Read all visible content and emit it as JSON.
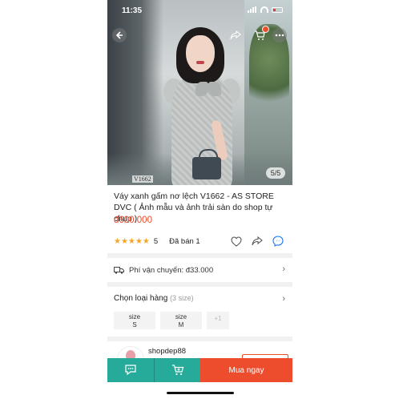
{
  "status_bar": {
    "time": "11:35"
  },
  "gallery": {
    "image_code": "V1662",
    "counter": "5/5"
  },
  "product": {
    "title": "Váy xanh gấm nơ lệch V1662 - AS STORE DVC ( Ảnh mẫu và ảnh trải sàn do shop tự chụp )",
    "price": "đ600.000",
    "stars": "★★★★★",
    "rating": "5",
    "sold": "Đã bán 1"
  },
  "shipping": {
    "label": "Phí vận chuyển: đ33.000"
  },
  "variants": {
    "label": "Chọn loại hàng",
    "count": "(3 size)",
    "options": [
      {
        "line1": "size",
        "line2": "S"
      },
      {
        "line1": "size",
        "line2": "M"
      }
    ],
    "more": "+1"
  },
  "shop": {
    "name": "shopdep88"
  },
  "bottom_bar": {
    "buy_label": "Mua ngay"
  },
  "colors": {
    "accent": "#ee4d2d",
    "teal": "#26aa99",
    "star": "#f5a623"
  },
  "icons": [
    "back-icon",
    "share-icon",
    "cart-icon",
    "more-icon",
    "heart-icon",
    "messenger-icon",
    "truck-icon",
    "chevron-right-icon",
    "chat-icon"
  ]
}
